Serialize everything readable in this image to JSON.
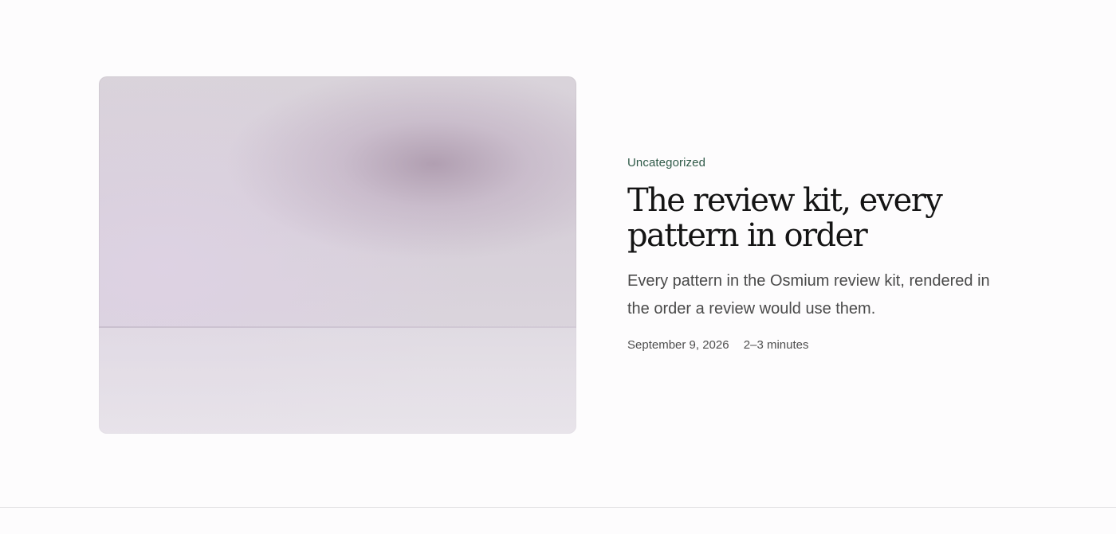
{
  "post": {
    "category": "Uncategorized",
    "title": "The review kit, every pattern in order",
    "excerpt": "Every pattern in the Osmium review kit, rendered in the order a review would use them.",
    "date": "September 9, 2026",
    "reading_time": "2–3 minutes"
  },
  "colors": {
    "category": "#2f5a48",
    "title": "#141414",
    "excerpt": "#4a4a4a",
    "background": "#fdfcfd"
  }
}
